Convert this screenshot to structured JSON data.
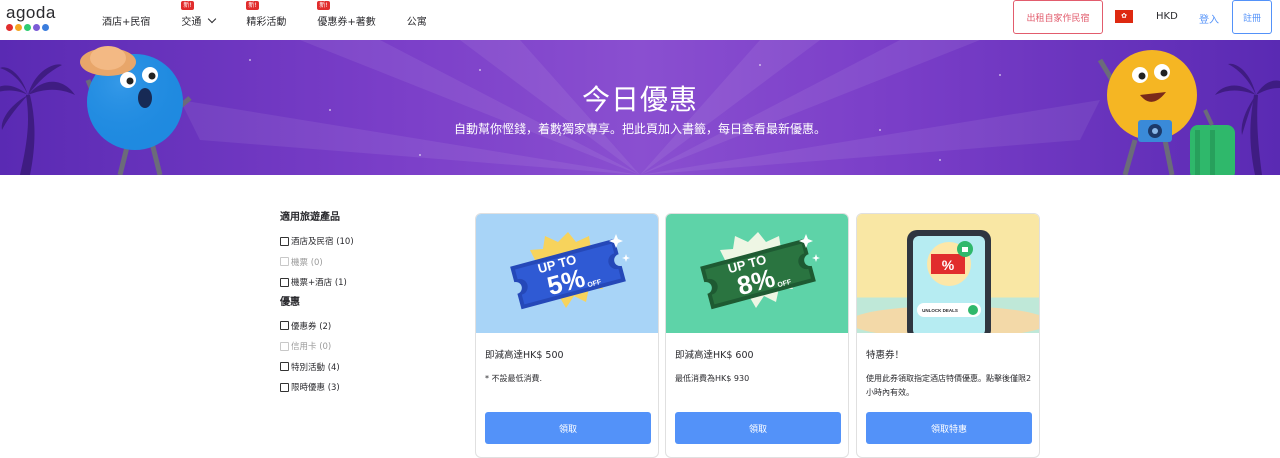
{
  "header": {
    "logo_text": "agoda",
    "logo_dot_colors": [
      "#e12d2d",
      "#f5a623",
      "#2ecc71",
      "#7b5cd6",
      "#3b7ddd"
    ],
    "nav": [
      {
        "label": "酒店+民宿",
        "badge": ""
      },
      {
        "label": "交通",
        "badge": "新!",
        "dropdown": true
      },
      {
        "label": "精彩活動",
        "badge": "新!"
      },
      {
        "label": "優惠券+著數",
        "badge": "新!"
      },
      {
        "label": "公寓",
        "badge": ""
      }
    ],
    "host_button": "出租自家作民宿",
    "currency": "HKD",
    "login": "登入",
    "signup": "註冊"
  },
  "banner": {
    "title": "今日優惠",
    "subtitle": "自動幫你慳錢，着數獨家專享。把此頁加入書籤，每日查看最新優惠。"
  },
  "filters": {
    "product_heading": "適用旅遊產品",
    "products": [
      {
        "label": "酒店及民宿 (10)",
        "enabled": true
      },
      {
        "label": "機票 (0)",
        "enabled": false
      },
      {
        "label": "機票+酒店 (1)",
        "enabled": true
      }
    ],
    "offer_heading": "優惠",
    "offers": [
      {
        "label": "優惠券 (2)",
        "enabled": true
      },
      {
        "label": "信用卡 (0)",
        "enabled": false
      },
      {
        "label": "特別活動 (4)",
        "enabled": true
      },
      {
        "label": "限時優惠 (3)",
        "enabled": true
      }
    ]
  },
  "cards": [
    {
      "image": {
        "upto": "UP TO",
        "pct": "5%",
        "off": "OFF",
        "bg": "#a8d4f7",
        "ticket": "#2548b8"
      },
      "title": "即減高達HK$ 500",
      "desc": "* 不設最低消費.",
      "button": "領取"
    },
    {
      "image": {
        "upto": "UP TO",
        "pct": "8%",
        "off": "OFF",
        "bg": "#5ed3a8",
        "ticket": "#23683a"
      },
      "title": "即減高達HK$ 600",
      "desc": "最低消費為HK$ 930",
      "button": "領取"
    },
    {
      "image": {
        "phone_text": "UNLOCK DEALS",
        "symbol": "%",
        "bg": "#f9e7a4"
      },
      "title": "特惠券！",
      "desc": "使用此券領取指定酒店特價優惠。點擊後僅限2小時內有效。",
      "button": "領取特惠"
    }
  ]
}
